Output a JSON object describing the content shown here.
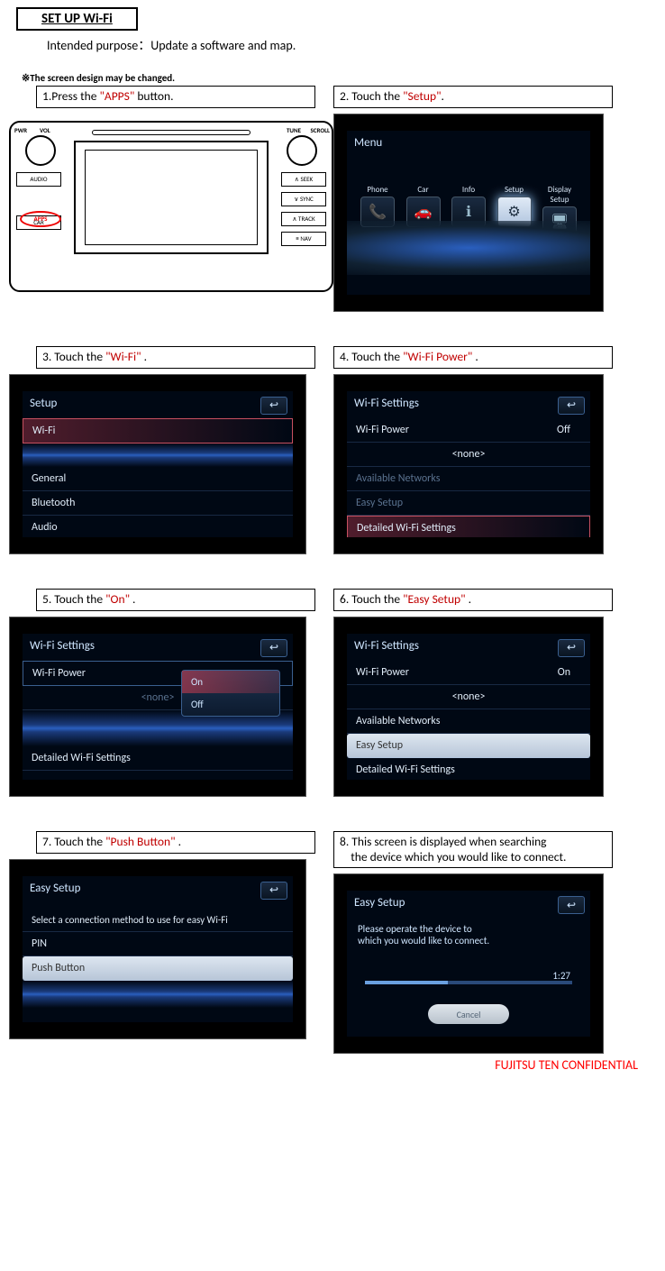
{
  "title": "SET UP Wi-Fi",
  "intended_label": "Intended purpose：",
  "intended_value": "Update a software and map.",
  "note": "※The screen  design may be changed.",
  "steps": {
    "s1": {
      "pre": "1.Press the ",
      "hl": "\"APPS\"",
      "post": " button."
    },
    "s2": {
      "pre": "2. Touch the ",
      "hl": "\"Setup\"",
      "post": "."
    },
    "s3": {
      "pre": "3. Touch the ",
      "hl": "\"Wi-Fi\"",
      "post": " ."
    },
    "s4": {
      "pre": "4. Touch the ",
      "hl": "\"Wi-Fi Power\"",
      "post": " ."
    },
    "s5": {
      "pre": "5. Touch the ",
      "hl": "\"On\"",
      "post": " ."
    },
    "s6": {
      "pre": "6. Touch the ",
      "hl": "\"Easy Setup\"",
      "post": " ."
    },
    "s7": {
      "pre": "7. Touch the ",
      "hl": "\"Push Button\"",
      "post": " ."
    },
    "s8_line1": "8. This screen is displayed when searching",
    "s8_line2": "the device which you would like to connect."
  },
  "hw": {
    "pwr": "PWR",
    "vol": "VOL",
    "tune": "TUNE",
    "scroll": "SCROLL",
    "audio": "AUDIO",
    "apps": "APPS",
    "car": "CAR",
    "seek": "∧ SEEK",
    "sync": "∨ SYNC",
    "track": "∧ TRACK",
    "nav": "≡ NAV"
  },
  "screen2": {
    "title": "Menu",
    "items": [
      "Phone",
      "Car",
      "Info",
      "Setup",
      "Display Setup"
    ],
    "icons": [
      "📞",
      "🚗",
      "ℹ",
      "⚙",
      "🖥"
    ]
  },
  "screen3": {
    "title": "Setup",
    "items": [
      "Wi-Fi",
      "General",
      "Bluetooth",
      "Audio"
    ]
  },
  "screen4": {
    "title": "Wi-Fi Settings",
    "power_label": "Wi-Fi Power",
    "power_value": "Off",
    "none": "<none>",
    "avail": "Available Networks",
    "easy": "Easy Setup",
    "detailed": "Detailed Wi-Fi Settings"
  },
  "screen5": {
    "title": "Wi-Fi Settings",
    "power_label": "Wi-Fi Power",
    "none": "<none>",
    "detailed": "Detailed Wi-Fi Settings",
    "on": "On",
    "off": "Off"
  },
  "screen6": {
    "title": "Wi-Fi Settings",
    "power_label": "Wi-Fi Power",
    "power_value": "On",
    "none": "<none>",
    "avail": "Available Networks",
    "easy": "Easy Setup",
    "detailed": "Detailed Wi-Fi Settings"
  },
  "screen7": {
    "title": "Easy Setup",
    "prompt": "Select a connection method to use for easy Wi-Fi",
    "pin": "PIN",
    "push": "Push Button"
  },
  "screen8": {
    "title": "Easy Setup",
    "msg1": "Please operate the device to",
    "msg2": "which you would like to connect.",
    "timer": "1:27",
    "cancel": "Cancel"
  },
  "footer": "FUJITSU TEN CONFIDENTIAL",
  "back_glyph": "↩"
}
